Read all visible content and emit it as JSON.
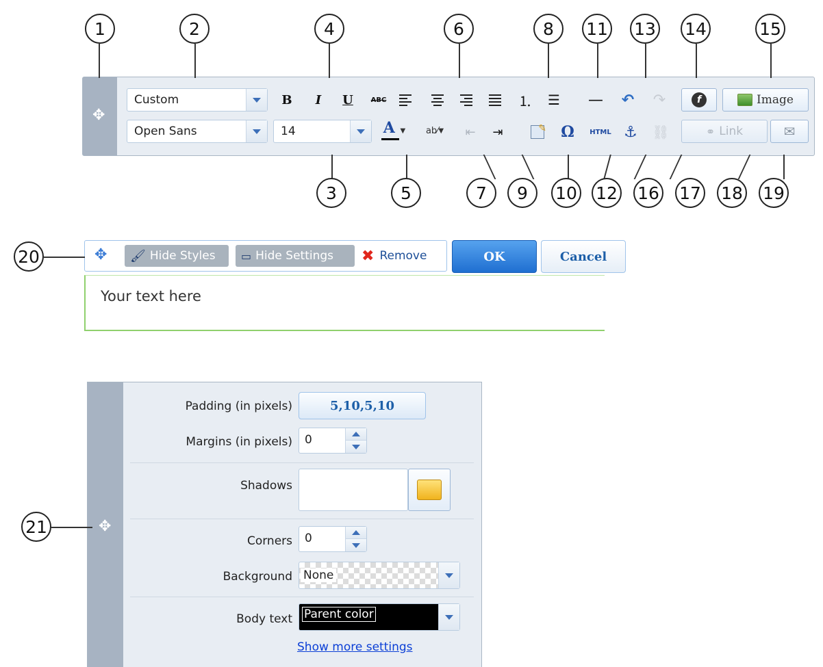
{
  "callouts": [
    "1",
    "2",
    "3",
    "4",
    "5",
    "6",
    "7",
    "8",
    "9",
    "10",
    "11",
    "12",
    "13",
    "14",
    "15",
    "16",
    "17",
    "18",
    "19",
    "20",
    "21"
  ],
  "toolbar": {
    "font_style_value": "Custom",
    "font_family_value": "Open Sans",
    "font_size_value": "14",
    "image_label": "Image",
    "link_label": "Link",
    "icons": [
      "move-icon",
      "bold-icon",
      "italic-icon",
      "underline-icon",
      "strikethrough-icon",
      "align-left-icon",
      "align-center-icon",
      "align-right-icon",
      "justify-icon",
      "numbered-list-icon",
      "bulleted-list-icon",
      "horizontal-rule-icon",
      "undo-icon",
      "redo-icon",
      "flash-icon",
      "image-icon",
      "font-color-icon",
      "highlight-icon",
      "outdent-icon",
      "indent-icon",
      "edit-icon",
      "special-char-icon",
      "html-icon",
      "anchor-icon",
      "unlink-icon",
      "link-icon",
      "email-icon"
    ]
  },
  "editor": {
    "hide_styles_label": "Hide Styles",
    "hide_settings_label": "Hide Settings",
    "remove_label": "Remove",
    "ok_label": "OK",
    "cancel_label": "Cancel",
    "content_text": "Your text here"
  },
  "settings": {
    "padding_label": "Padding (in pixels)",
    "padding_value": "5,10,5,10",
    "margins_label": "Margins (in pixels)",
    "margins_value": "0",
    "shadows_label": "Shadows",
    "corners_label": "Corners",
    "corners_value": "0",
    "background_label": "Background",
    "background_value": "None",
    "body_text_label": "Body text",
    "body_text_value": "Parent color",
    "show_more_label": "Show more settings"
  },
  "colors": {
    "accent_blue": "#1f6fd1",
    "handle_gray": "#a7b3c2",
    "panel_bg": "#e8edf3",
    "green_border": "#8fd06d",
    "link": "#0b3fd6"
  }
}
